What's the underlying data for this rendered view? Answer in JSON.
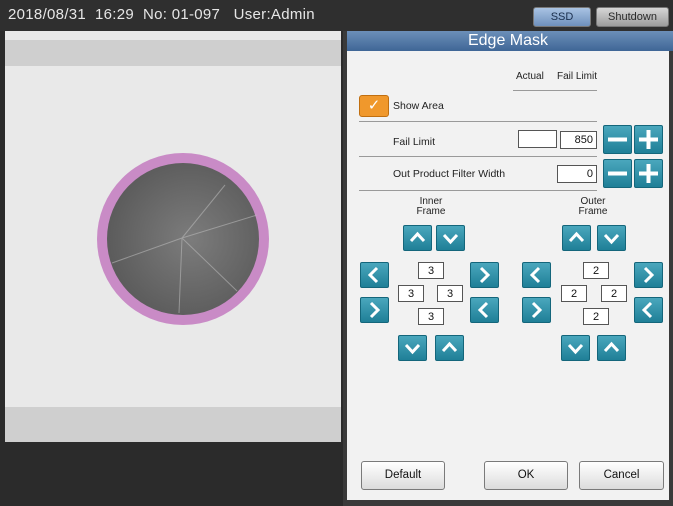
{
  "status_bar": {
    "text": "2018/08/31  16:29  No: 01-097   User:Admin",
    "ssd_label": "SSD",
    "shutdown_label": "Shutdown"
  },
  "panel": {
    "title": "Edge Mask",
    "columns": {
      "actual": "Actual",
      "fail_limit": "Fail Limit"
    },
    "show_area": {
      "label": "Show Area",
      "checked": true
    },
    "fail_limit": {
      "label": "Fail Limit",
      "actual": "",
      "value": "850"
    },
    "out_product_filter": {
      "label": "Out Product Filter Width",
      "value": "0"
    },
    "inner_frame": {
      "title_line1": "Inner",
      "title_line2": "Frame",
      "top": "3",
      "left": "3",
      "right": "3",
      "bottom": "3"
    },
    "outer_frame": {
      "title_line1": "Outer",
      "title_line2": "Frame",
      "top": "2",
      "left": "2",
      "right": "2",
      "bottom": "2"
    },
    "buttons": {
      "default": "Default",
      "ok": "OK",
      "cancel": "Cancel"
    }
  },
  "colors": {
    "accent_teal": "#1f7f97",
    "checkbox_orange": "#f0982c",
    "mask_pink": "#c98bc6",
    "header_blue": "#3f6696"
  }
}
